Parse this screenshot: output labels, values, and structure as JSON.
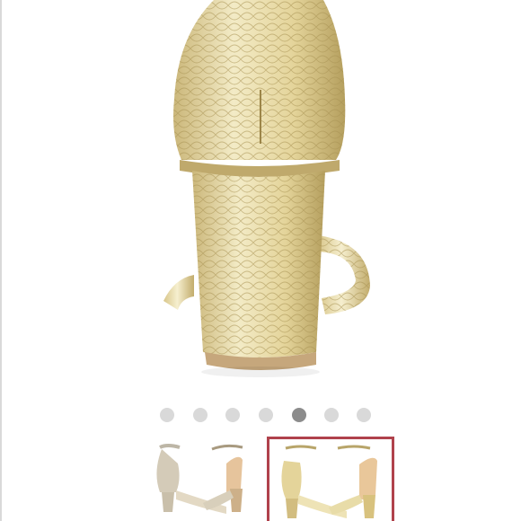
{
  "gallery": {
    "main_image": {
      "icon": "gold-snakeskin-heel-back-view",
      "colors": {
        "gold": "#e9dca6",
        "gold_dark": "#b8a56a",
        "sole": "#c6a77c"
      }
    },
    "dots": {
      "count": 7,
      "active_index": 4,
      "colors": {
        "inactive": "#d9d9d9",
        "active": "#8c8c8c"
      }
    },
    "thumbnails": [
      {
        "icon": "silver-sandal-pair-thumbnail",
        "selected": false
      },
      {
        "icon": "gold-sandal-pair-thumbnail",
        "selected": true,
        "selected_border_color": "#b0424c"
      }
    ]
  }
}
